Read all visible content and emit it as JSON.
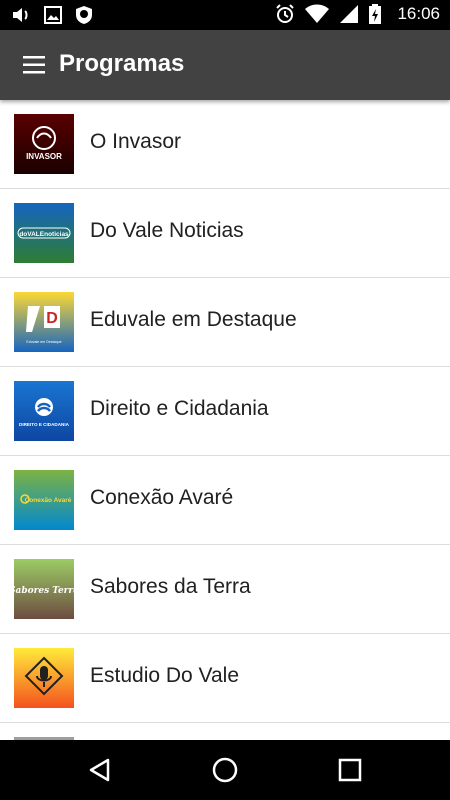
{
  "status_bar": {
    "time": "16:06",
    "left_icons": [
      "volume-icon",
      "image-icon",
      "shield-icon"
    ],
    "right_icons": [
      "alarm-icon",
      "wifi-icon",
      "signal-icon",
      "battery-icon"
    ]
  },
  "app_bar": {
    "title": "Programas",
    "menu_icon": "hamburger-menu-icon"
  },
  "programs": [
    {
      "label": "O Invasor",
      "thumb_text": "INVASOR",
      "thumb_colors": [
        "#5a0000",
        "#1a0000"
      ]
    },
    {
      "label": "Do Vale Noticias",
      "thumb_text": "doVALEnoticias",
      "thumb_colors": [
        "#1565c0",
        "#2e7d32"
      ]
    },
    {
      "label": "Eduvale em Destaque",
      "thumb_text": "Eduvale em Destaque",
      "thumb_colors": [
        "#fdd835",
        "#1565c0"
      ]
    },
    {
      "label": "Direito e Cidadania",
      "thumb_text": "DIREITO E CIDADANIA",
      "thumb_colors": [
        "#1976d2",
        "#0d47a1"
      ]
    },
    {
      "label": "Conexão Avaré",
      "thumb_text": "Conexão Avaré",
      "thumb_colors": [
        "#7cb342",
        "#0288d1"
      ]
    },
    {
      "label": "Sabores da Terra",
      "thumb_text": "Sabores Terra",
      "thumb_colors": [
        "#9ccc65",
        "#6d4c41"
      ]
    },
    {
      "label": "Estudio Do Vale",
      "thumb_text": "",
      "thumb_colors": [
        "#ffeb3b",
        "#f4511e"
      ]
    }
  ],
  "nav_bar": {
    "back_icon": "back-triangle-icon",
    "home_icon": "home-circle-icon",
    "recents_icon": "recents-square-icon"
  }
}
